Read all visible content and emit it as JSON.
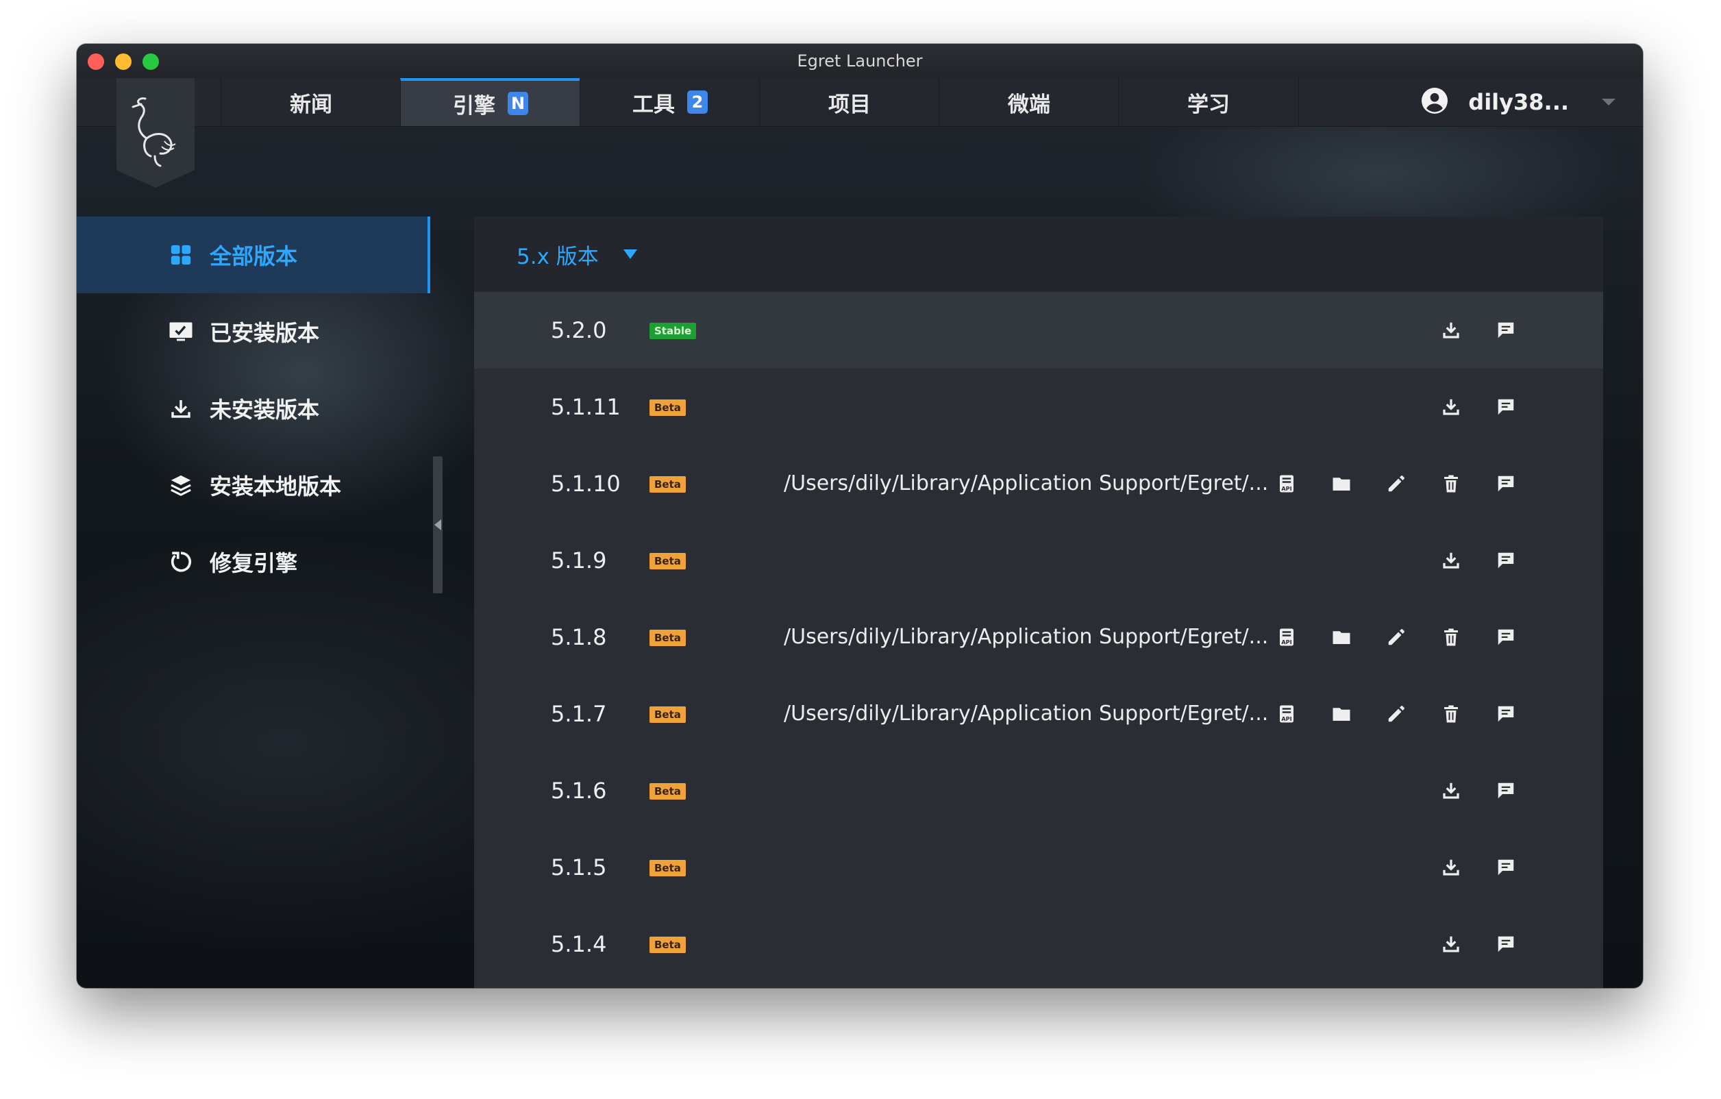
{
  "window": {
    "title": "Egret Launcher"
  },
  "nav": {
    "tabs": [
      {
        "label": "新闻",
        "badge": ""
      },
      {
        "label": "引擎",
        "badge": "N",
        "active": true
      },
      {
        "label": "工具",
        "badge": "2"
      },
      {
        "label": "项目",
        "badge": ""
      },
      {
        "label": "微端",
        "badge": ""
      },
      {
        "label": "学习",
        "badge": ""
      }
    ],
    "user": {
      "name": "dily38..."
    }
  },
  "sidebar": {
    "items": [
      {
        "label": "全部版本",
        "icon": "grid-icon",
        "active": true
      },
      {
        "label": "已安装版本",
        "icon": "monitor-check-icon"
      },
      {
        "label": "未安装版本",
        "icon": "download-icon"
      },
      {
        "label": "安装本地版本",
        "icon": "layers-icon"
      },
      {
        "label": "修复引擎",
        "icon": "refresh-icon"
      }
    ]
  },
  "panel": {
    "version_filter": "5.x 版本",
    "rows": [
      {
        "version": "5.2.0",
        "tag": "Stable",
        "path": "",
        "installed": false
      },
      {
        "version": "5.1.11",
        "tag": "Beta",
        "path": "",
        "installed": false
      },
      {
        "version": "5.1.10",
        "tag": "Beta",
        "path": "/Users/dily/Library/Application Support/Egret/...",
        "installed": true
      },
      {
        "version": "5.1.9",
        "tag": "Beta",
        "path": "",
        "installed": false
      },
      {
        "version": "5.1.8",
        "tag": "Beta",
        "path": "/Users/dily/Library/Application Support/Egret/...",
        "installed": true
      },
      {
        "version": "5.1.7",
        "tag": "Beta",
        "path": "/Users/dily/Library/Application Support/Egret/...",
        "installed": true
      },
      {
        "version": "5.1.6",
        "tag": "Beta",
        "path": "",
        "installed": false
      },
      {
        "version": "5.1.5",
        "tag": "Beta",
        "path": "",
        "installed": false
      },
      {
        "version": "5.1.4",
        "tag": "Beta",
        "path": "",
        "installed": false
      }
    ]
  },
  "colors": {
    "accent": "#1e95f2",
    "stable": "#1f9e33",
    "beta": "#f0a23a"
  }
}
